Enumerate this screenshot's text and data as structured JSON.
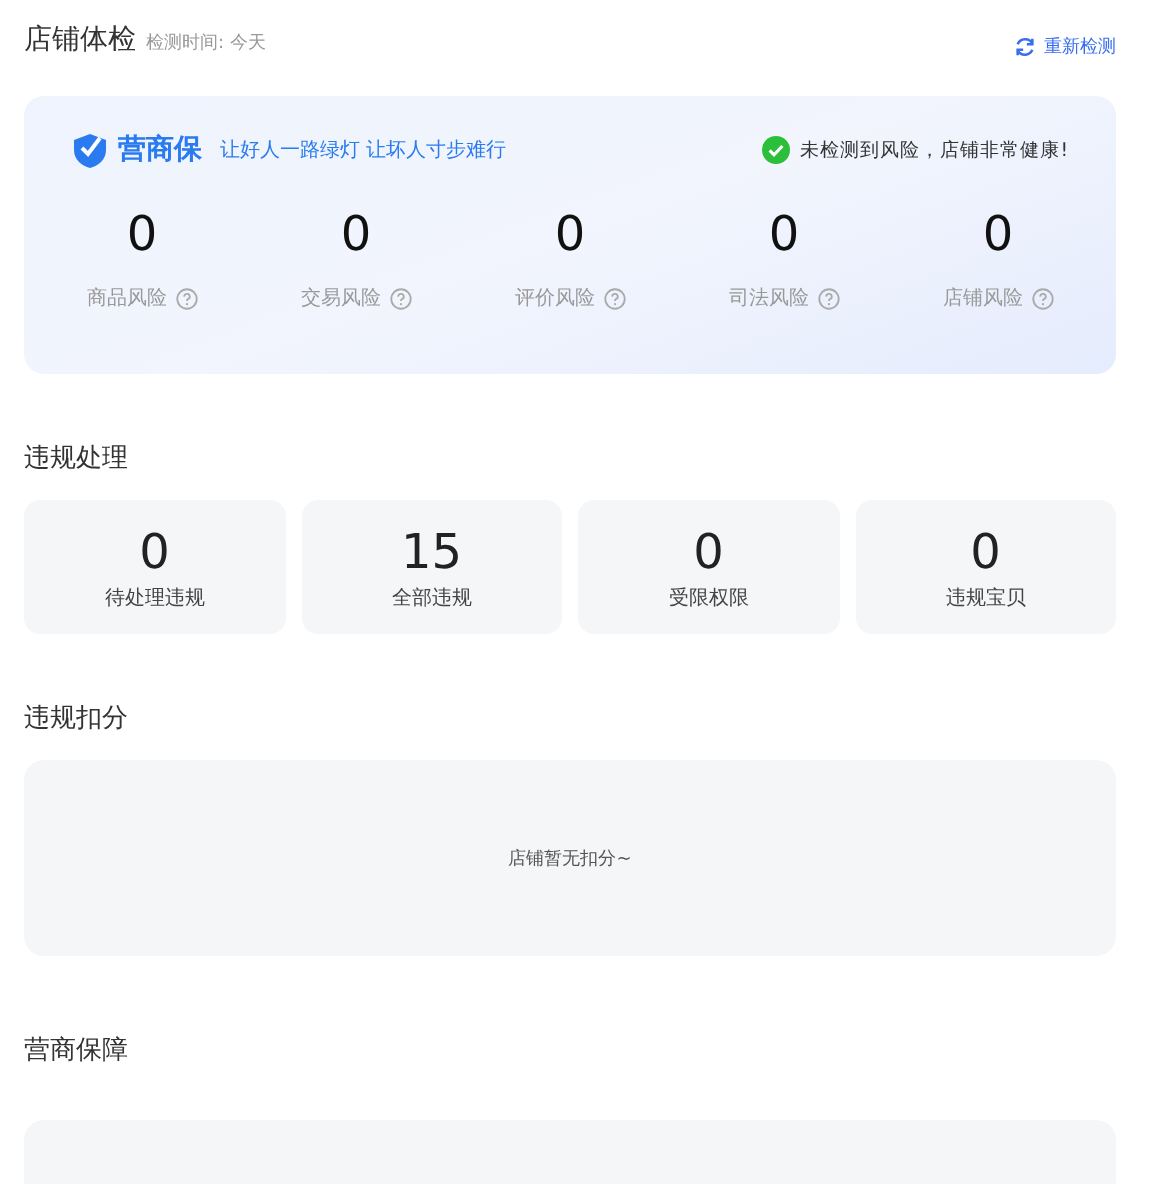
{
  "header": {
    "title": "店铺体检",
    "check_time": "检测时间: 今天",
    "recheck_link": "重新检测"
  },
  "banner": {
    "brand": "营商保",
    "slogan": "让好人一路绿灯 让坏人寸步难行",
    "status": "未检测到风险，店铺非常健康!",
    "risks": [
      {
        "value": "0",
        "label": "商品风险"
      },
      {
        "value": "0",
        "label": "交易风险"
      },
      {
        "value": "0",
        "label": "评价风险"
      },
      {
        "value": "0",
        "label": "司法风险"
      },
      {
        "value": "0",
        "label": "店铺风险"
      }
    ]
  },
  "violations": {
    "title": "违规处理",
    "stats": [
      {
        "value": "0",
        "label": "待处理违规"
      },
      {
        "value": "15",
        "label": "全部违规"
      },
      {
        "value": "0",
        "label": "受限权限"
      },
      {
        "value": "0",
        "label": "违规宝贝"
      }
    ]
  },
  "deductions": {
    "title": "违规扣分",
    "empty_text": "店铺暂无扣分~"
  },
  "guarantee": {
    "title": "营商保障"
  }
}
